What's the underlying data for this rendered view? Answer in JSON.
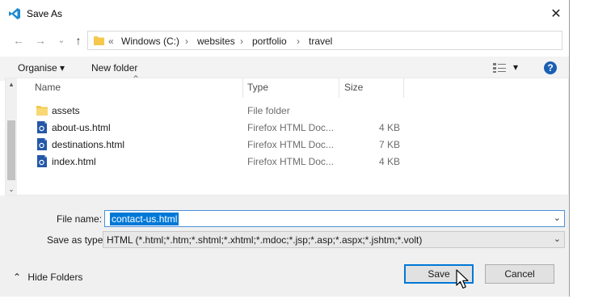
{
  "window": {
    "title": "Save As",
    "close_glyph": "✕"
  },
  "nav": {
    "back_glyph": "←",
    "forward_glyph": "→",
    "recent_glyph": "⌄",
    "up_glyph": "↑"
  },
  "address": {
    "prefix": "«",
    "crumbs": [
      "Windows (C:)",
      "websites",
      "portfolio",
      "travel"
    ],
    "separator": "›"
  },
  "toolbar": {
    "organise_label": "Organise ▾",
    "new_folder_label": "New folder",
    "view_dropdown_glyph": "▾",
    "help_glyph": "?"
  },
  "columns": {
    "name": "Name",
    "type": "Type",
    "size": "Size",
    "sort_glyph": "⌃"
  },
  "files": [
    {
      "name": "assets",
      "type": "File folder",
      "size": "",
      "icon": "folder-icon"
    },
    {
      "name": "about-us.html",
      "type": "Firefox HTML Doc...",
      "size": "4 KB",
      "icon": "html-file-icon"
    },
    {
      "name": "destinations.html",
      "type": "Firefox HTML Doc...",
      "size": "7 KB",
      "icon": "html-file-icon"
    },
    {
      "name": "index.html",
      "type": "Firefox HTML Doc...",
      "size": "4 KB",
      "icon": "html-file-icon"
    }
  ],
  "scroll": {
    "up_glyph": "▴",
    "down_glyph": "⌄"
  },
  "form": {
    "file_name_label": "File name:",
    "file_name_value": "contact-us.html",
    "save_as_type_label": "Save as type:",
    "save_as_type_value": "HTML (*.html;*.htm;*.shtml;*.xhtml;*.mdoc;*.jsp;*.asp;*.aspx;*.jshtm;*.volt)",
    "dropdown_glyph": "⌄"
  },
  "footer": {
    "hide_folders_label": "Hide Folders",
    "hide_folders_glyph": "⌃",
    "save_label": "Save",
    "cancel_label": "Cancel"
  },
  "colors": {
    "accent": "#0078d7",
    "folder": "#f5c84c",
    "help": "#1a5fb4"
  }
}
